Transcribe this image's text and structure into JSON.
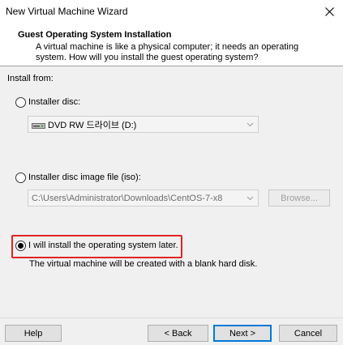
{
  "window": {
    "title": "New Virtual Machine Wizard",
    "close_icon": "close-icon"
  },
  "header": {
    "title": "Guest Operating System Installation",
    "description": "A virtual machine is like a physical computer; it needs an operating system. How will you install the guest operating system?"
  },
  "install_from": {
    "label": "Install from:",
    "options": [
      {
        "label": "Installer disc:",
        "selected": false
      },
      {
        "label": "Installer disc image file (iso):",
        "selected": false
      },
      {
        "label": "I will install the operating system later.",
        "selected": true
      }
    ],
    "disc_combo_value": "DVD RW 드라이브 (D:)",
    "iso_path_value": "C:\\Users\\Administrator\\Downloads\\CentOS-7-x8",
    "browse_label": "Browse...",
    "later_description": "The virtual machine will be created with a blank hard disk."
  },
  "footer": {
    "help": "Help",
    "back": "< Back",
    "next": "Next >",
    "cancel": "Cancel"
  },
  "colors": {
    "highlight": "#e02424",
    "accent": "#0078d7"
  }
}
